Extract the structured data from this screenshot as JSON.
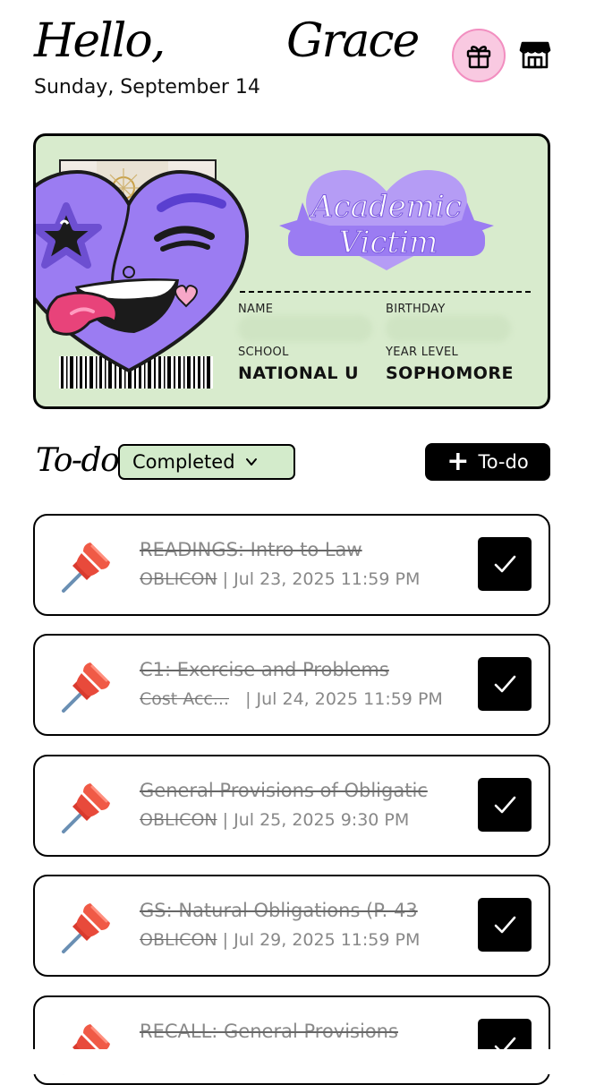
{
  "header": {
    "greeting": "Hello,",
    "user_name": "Grace",
    "date": "Sunday, September 14",
    "gift_icon": "gift-icon",
    "store_icon": "store-icon",
    "gift_bg": "#f9c9e1"
  },
  "id_card": {
    "logo_line1": "Academic",
    "logo_line2": "Victim",
    "name_label": "NAME",
    "birthday_label": "BIRTHDAY",
    "school_label": "SCHOOL",
    "school_value": "NATIONAL U",
    "year_label": "YEAR LEVEL",
    "year_value": "SOPHOMORE",
    "background": "#d8ebcd",
    "accent": "#9b7cf2"
  },
  "todo": {
    "title": "To-do",
    "filter_value": "Completed",
    "add_label": "To-do",
    "tasks": [
      {
        "title": "READINGS: Intro to Law",
        "course": "OBLICON",
        "due": "Jul 23, 2025 11:59 PM",
        "completed": true
      },
      {
        "title": "C1: Exercise and Problems",
        "course": "Cost Acc...",
        "due": "Jul 24, 2025 11:59 PM",
        "completed": true
      },
      {
        "title": "General Provisions of Obligatic",
        "course": "OBLICON",
        "due": "Jul 25, 2025 9:30 PM",
        "completed": true
      },
      {
        "title": "GS: Natural Obligations (P. 43",
        "course": "OBLICON",
        "due": "Jul 29, 2025 11:59 PM",
        "completed": true
      },
      {
        "title": "RECALL: General Provisions",
        "course": "",
        "due": "",
        "completed": true
      }
    ]
  }
}
